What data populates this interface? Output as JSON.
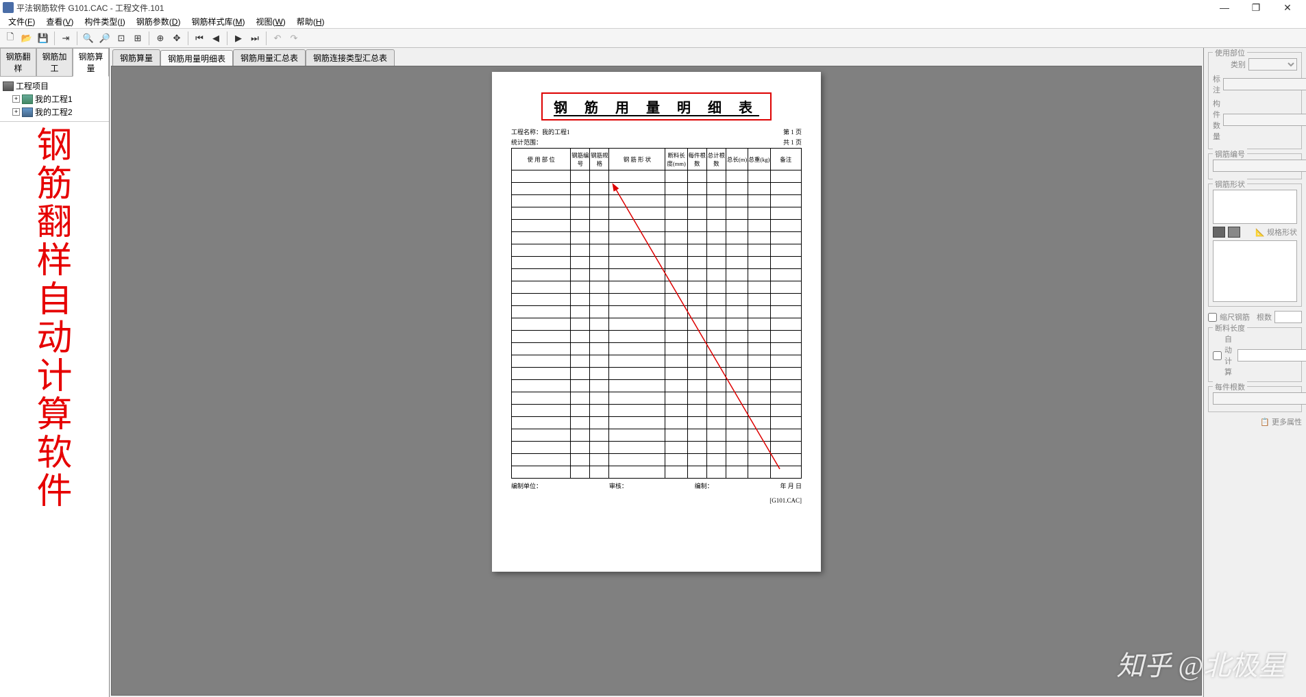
{
  "titlebar": {
    "title": "平法钢筋软件 G101.CAC - 工程文件.101"
  },
  "menubar": {
    "items": [
      {
        "label": "文件",
        "accel": "F"
      },
      {
        "label": "查看",
        "accel": "V"
      },
      {
        "label": "构件类型",
        "accel": "I"
      },
      {
        "label": "钢筋参数",
        "accel": "D"
      },
      {
        "label": "钢筋样式库",
        "accel": "M"
      },
      {
        "label": "视图",
        "accel": "W"
      },
      {
        "label": "帮助",
        "accel": "H"
      }
    ]
  },
  "toolbar_icons": [
    "new",
    "open",
    "save",
    "|",
    "export",
    "|",
    "zoom-in",
    "zoom-out",
    "zoom-fit",
    "zoom-actual",
    "|",
    "zoom-window",
    "pan",
    "|",
    "page-first",
    "page-prev",
    "|",
    "page-next",
    "page-last",
    "|",
    "undo",
    "redo"
  ],
  "left": {
    "tabs": [
      "钢筋翻样",
      "钢筋加工",
      "钢筋算量"
    ],
    "active_tab": 2,
    "tree_root": "工程项目",
    "tree_items": [
      "我的工程1",
      "我的工程2"
    ],
    "bigtext": [
      "钢",
      "筋",
      "翻",
      "样",
      "自",
      "动",
      "计",
      "算",
      "软",
      "件"
    ]
  },
  "doc": {
    "tabs": [
      "钢筋算量",
      "钢筋用量明细表",
      "钢筋用量汇总表",
      "钢筋连接类型汇总表"
    ],
    "active_tab": 1
  },
  "page": {
    "title": "钢 筋 用 量 明 细 表",
    "proj_label": "工程名称：",
    "proj_name": "我的工程1",
    "stat_label": "统计范围：",
    "page_info_top": "第 1 页",
    "page_info_total": "共 1 页",
    "columns": [
      "使 用 部 位",
      "钢筋编号",
      "钢筋规格",
      "钢 筋 形 状",
      "断料长度(mm)",
      "每件根数",
      "总计根数",
      "总长(m)",
      "总重(kg)",
      "备注"
    ],
    "row_count": 25,
    "foot": {
      "a": "编制单位：",
      "b": "审核：",
      "c": "编制：",
      "d": "年  月  日"
    },
    "foot2": "[G101.CAC]"
  },
  "right": {
    "g1_title": "使用部位",
    "g1_rows": [
      {
        "label": "类别"
      },
      {
        "label": "标注"
      },
      {
        "label": "构件数量"
      }
    ],
    "g2_title": "钢筋编号",
    "g3_title": "钢筋形状",
    "g3_btn": "规格形状",
    "chk_scale": "缩尺钢筋",
    "lbl_count": "根数",
    "g4_title": "断料长度",
    "g4_chk": "自动计算",
    "g5_title": "每件根数",
    "more_btn": "更多属性"
  },
  "watermark": "知乎 @北极星"
}
